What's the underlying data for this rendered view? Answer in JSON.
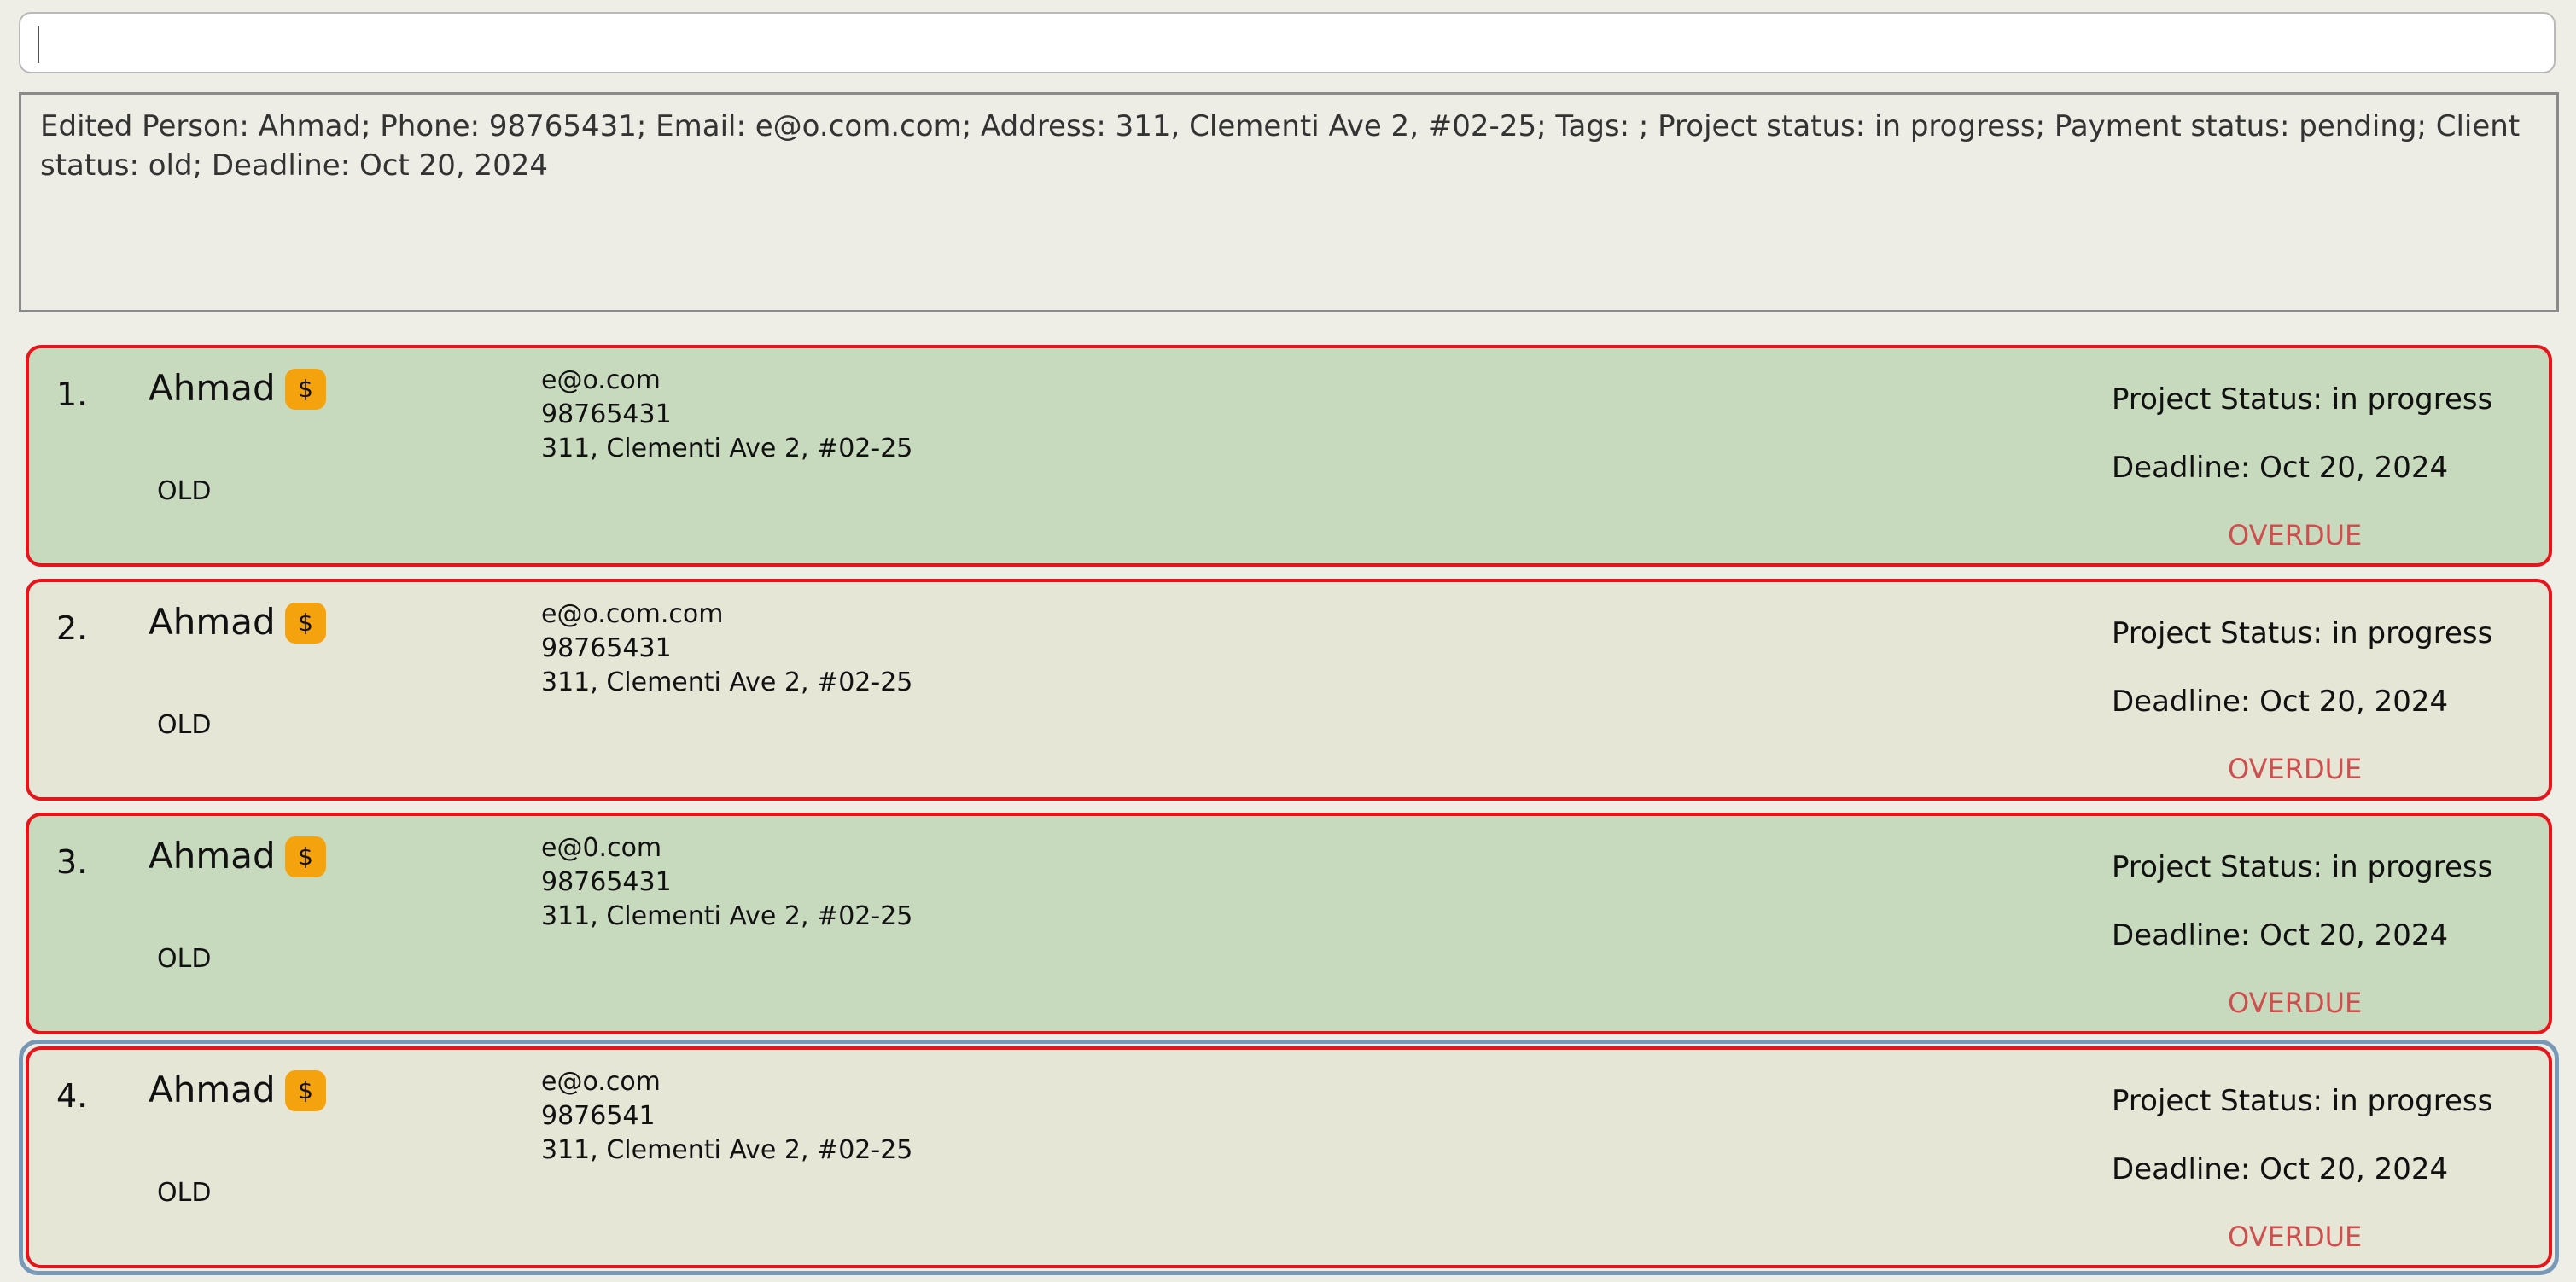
{
  "command": {
    "value": "",
    "placeholder": ""
  },
  "result": {
    "text": "Edited Person: Ahmad; Phone: 98765431; Email: e@o.com.com; Address: 311, Clementi Ave 2, #02-25; Tags: ; Project status: in progress; Payment status: pending; Client status: old; Deadline: Oct 20, 2024"
  },
  "persons": [
    {
      "index": "1.",
      "name": "Ahmad",
      "payment_badge": "$",
      "client_status": "OLD",
      "email": "e@o.com",
      "phone": "98765431",
      "address": "311, Clementi Ave 2, #02-25",
      "project_status": "Project Status: in progress",
      "deadline": "Deadline: Oct 20, 2024",
      "overdue": "OVERDUE"
    },
    {
      "index": "2.",
      "name": "Ahmad",
      "payment_badge": "$",
      "client_status": "OLD",
      "email": "e@o.com.com",
      "phone": "98765431",
      "address": "311, Clementi Ave 2, #02-25",
      "project_status": "Project Status: in progress",
      "deadline": "Deadline: Oct 20, 2024",
      "overdue": "OVERDUE"
    },
    {
      "index": "3.",
      "name": "Ahmad",
      "payment_badge": "$",
      "client_status": "OLD",
      "email": "e@0.com",
      "phone": "98765431",
      "address": "311, Clementi Ave 2, #02-25",
      "project_status": "Project Status: in progress",
      "deadline": "Deadline: Oct 20, 2024",
      "overdue": "OVERDUE"
    },
    {
      "index": "4.",
      "name": "Ahmad",
      "payment_badge": "$",
      "client_status": "OLD",
      "email": "e@o.com",
      "phone": "9876541",
      "address": "311, Clementi Ave 2, #02-25",
      "project_status": "Project Status: in progress",
      "deadline": "Deadline: Oct 20, 2024",
      "overdue": "OVERDUE"
    }
  ],
  "colors": {
    "card_alternate": "#c8dabe",
    "card_default": "#e6e6d7",
    "card_border_overdue": "#e8141c",
    "selected_outline": "#7898b8",
    "payment_badge": "#f5a20f",
    "overdue_text": "#cf4f4f"
  },
  "icons": {
    "payment_badge": "dollar-sign-icon"
  }
}
